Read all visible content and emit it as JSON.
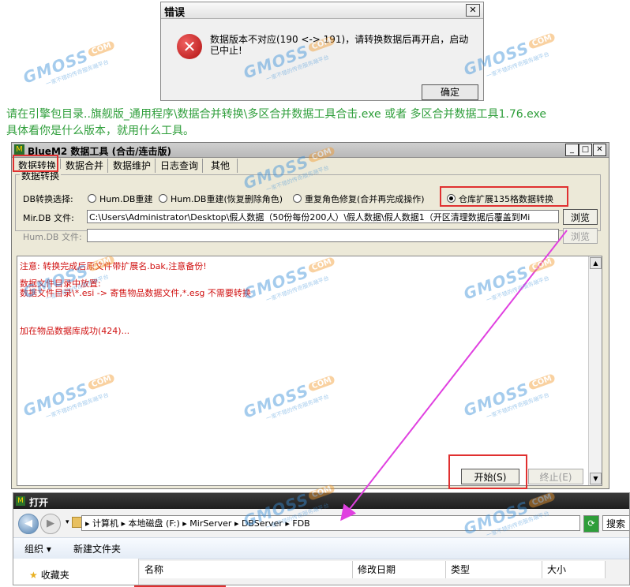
{
  "error_dialog": {
    "title": "错误",
    "close": "✕",
    "icon": "error-icon",
    "message": "数据版本不对应(190 <-> 191)，请转换数据后再开启，启动已中止!",
    "ok_label": "确定"
  },
  "instructions": [
    "请在引擎包目录..旗舰版_通用程序\\数据合并转换\\多区合并数据工具合击.exe 或者 多区合并数据工具1.76.exe",
    "具体看你是什么版本，就用什么工具。"
  ],
  "tool": {
    "title": "BlueM2 数据工具 (合击/连击版)",
    "window_controls": [
      "_",
      "□",
      "✕"
    ],
    "tabs": [
      "数据转换",
      "数据合并",
      "数据维护",
      "日志查询",
      "其他"
    ],
    "group_title": "数据转换",
    "db_label": "DB转换选择:",
    "radios": [
      {
        "label": "Hum.DB重建",
        "checked": false
      },
      {
        "label": "Hum.DB重建(恢复删除角色)",
        "checked": false
      },
      {
        "label": "重复角色修复(合并再完成操作)",
        "checked": false
      },
      {
        "label": "仓库扩展135格数据转换",
        "checked": true
      }
    ],
    "mir_label": "Mir.DB 文件:",
    "mir_value": "C:\\Users\\Administrator\\Desktop\\假人数据（50份每份200人）\\假人数据\\假人数据1（开区清理数据后覆盖到Mi",
    "hum_label": "Hum.DB 文件:",
    "hum_value": "",
    "browse_label": "浏览",
    "browse2_label": "浏览",
    "log": [
      "注意: 转换完成后原文件带扩展名.bak,注意备份!",
      "",
      "数据文件目录中放置:",
      "数据文件目录\\*.esi       ->   寄售物品数据文件,*.esg 不需要转换",
      "",
      "",
      "加在物品数据库成功(424)..."
    ],
    "start_label": "开始(S)",
    "stop_label": "终止(E)"
  },
  "open_dialog": {
    "title": "打开",
    "back": "◀",
    "forward": "▶",
    "address": "▸ 计算机 ▸ 本地磁盘 (F:) ▸ MirServer ▸ DBServer ▸ FDB",
    "search": "搜索",
    "organize": "组织 ▾",
    "new_folder": "新建文件夹",
    "favorites": "收藏夹",
    "columns": [
      "名称",
      "修改日期",
      "类型",
      "大小"
    ]
  },
  "watermark": {
    "brand": "GMOSS",
    "suffix": "COM",
    "tagline": "一家不错的传奇服务端平台"
  },
  "colors": {
    "instruction_green": "#2e9e3a",
    "log_red": "#d01010",
    "highlight_red": "#e03030",
    "arrow_magenta": "#e040e0"
  }
}
